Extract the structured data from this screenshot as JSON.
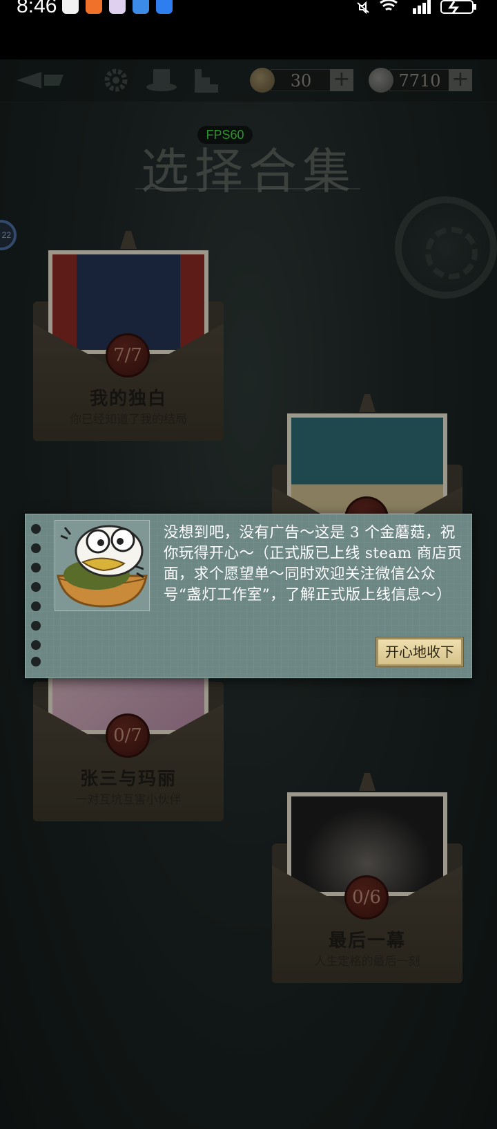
{
  "status_bar": {
    "time": "8:46",
    "battery_icon": "battery-charging-icon",
    "icons": [
      "qq-icon",
      "taobao-icon",
      "gallery-icon",
      "telegram-icon",
      "browser-icon",
      "mute-icon",
      "wifi-icon",
      "signal-icon"
    ]
  },
  "top_bar": {
    "icons": [
      "quill-pen-icon",
      "gear-icon",
      "hat-icon",
      "stairs-icon"
    ],
    "gold_mushroom": {
      "value": "30",
      "plus": "+",
      "icon": "mushroom-coin-icon"
    },
    "coins": {
      "value": "7710",
      "plus": "+",
      "icon": "coin-icon"
    }
  },
  "fps_badge": "FPS60",
  "page_title": "选择合集",
  "side_bubble": "22",
  "collections": [
    {
      "title": "我的独白",
      "subtitle": "你已经知道了我的结局",
      "progress": "7/7"
    },
    {
      "title": "",
      "subtitle": "",
      "progress": ""
    },
    {
      "title": "张三与玛丽",
      "subtitle": "一对互坑互害小伙伴",
      "progress": "0/7"
    },
    {
      "title": "最后一幕",
      "subtitle": "人生定格的最后一刻",
      "progress": "0/6"
    }
  ],
  "dialog": {
    "avatar_icon": "mushroom-mascot-icon",
    "message": "没想到吧，没有广告～这是 3 个金蘑菇，祝你玩得开心～（正式版已上线 steam 商店页面，求个愿望单～同时欢迎关注微信公众号“盏灯工作室”，了解正式版上线信息～）",
    "accept_button": "开心地收下"
  },
  "colors": {
    "fps_green": "#3ddc3d",
    "dialog_bg": "#6c8784",
    "button_gold": "#eedfae",
    "wax_seal": "#5a2018"
  }
}
